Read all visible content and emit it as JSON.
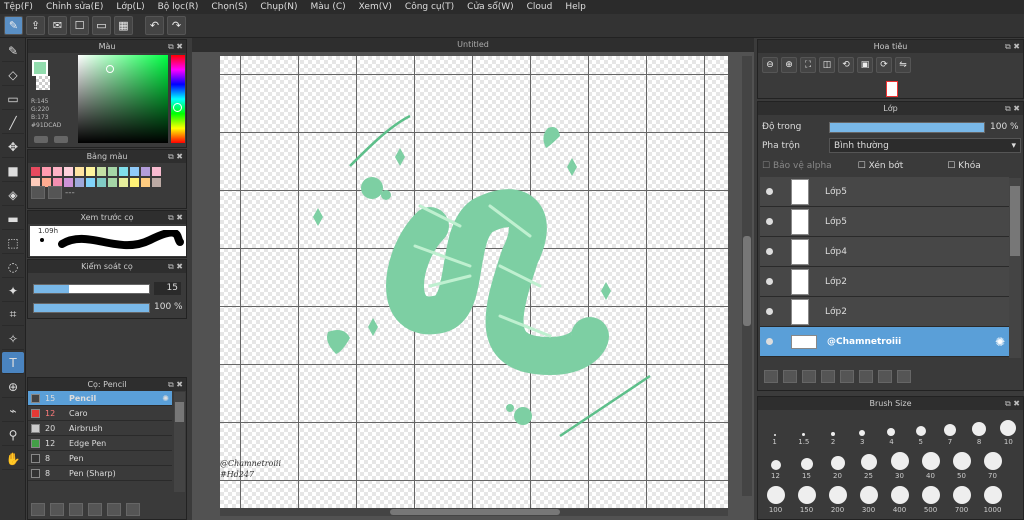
{
  "menu": [
    "Tệp(F)",
    "Chỉnh sửa(E)",
    "Lớp(L)",
    "Bộ lọc(R)",
    "Chọn(S)",
    "Chụp(N)",
    "Màu (C)",
    "Xem(V)",
    "Công cụ(T)",
    "Cửa sổ(W)",
    "Cloud",
    "Help"
  ],
  "panels": {
    "color": "Màu",
    "palette": "Bảng màu",
    "brush_preview": "Xem trước cọ",
    "brush_control": "Kiểm soát cọ",
    "brush_list": "Cọ: Pencil",
    "navigator": "Hoa tiêu",
    "layer": "Lớp",
    "brush_size": "Brush Size"
  },
  "color": {
    "r": "R:145",
    "g": "G:220",
    "b": "B:173",
    "hex": "#91DCAD",
    "main": "#91dcad"
  },
  "palette": {
    "colors": [
      "#e84a5f",
      "#ff9bb0",
      "#ffb3c6",
      "#ffd1dc",
      "#ffe4a1",
      "#fff59d",
      "#c5e1a5",
      "#a5d6a7",
      "#80deea",
      "#90caf9",
      "#b39ddb",
      "#f8bbd0",
      "#ffccbc",
      "#ffab91",
      "#f48fb1",
      "#ce93d8",
      "#9fa8da",
      "#81d4fa",
      "#80cbc4",
      "#a5d6a7",
      "#e6ee9c",
      "#fff176",
      "#ffcc80",
      "#bcaaa4"
    ],
    "dashes": "---"
  },
  "brush_preview": {
    "size": "1.09h"
  },
  "brush_control": {
    "size": "15",
    "opacity": "100 %"
  },
  "brushes": [
    {
      "size": "15",
      "name": "Pencil",
      "color": "#444",
      "sel": true
    },
    {
      "size": "12",
      "name": "Caro",
      "color": "#e53935"
    },
    {
      "size": "20",
      "name": "Airbrush",
      "color": "#ccc"
    },
    {
      "size": "12",
      "name": "Edge Pen",
      "color": "#43a047"
    },
    {
      "size": "8",
      "name": "Pen",
      "color": "#333"
    },
    {
      "size": "8",
      "name": "Pen (Sharp)",
      "color": "#333"
    }
  ],
  "canvas": {
    "title": "Untitled",
    "watermark1": "@Chamnetroiii",
    "watermark2": "#Hd247",
    "ink": "#7dcfa3",
    "ink2": "#5dbf8a"
  },
  "layer": {
    "opacity_label": "Độ trong",
    "opacity_value": "100 %",
    "blend_label": "Pha trộn",
    "blend_value": "Bình thường",
    "protect_alpha": "Bảo vệ alpha",
    "clip": "Xén bớt",
    "lock": "Khóa",
    "rows": [
      {
        "name": "Lớp5"
      },
      {
        "name": "Lớp5"
      },
      {
        "name": "Lớp4"
      },
      {
        "name": "Lớp2"
      },
      {
        "name": "Lớp2"
      },
      {
        "name": "@Chamnetroiii",
        "sel": true
      }
    ]
  },
  "brush_sizes": [
    [
      "1",
      "1.5",
      "2",
      "3",
      "4",
      "5",
      "7",
      "8",
      "10"
    ],
    [
      "12",
      "15",
      "20",
      "25",
      "30",
      "40",
      "50",
      "70"
    ],
    [
      "100",
      "150",
      "200",
      "300",
      "400",
      "500",
      "700",
      "1000"
    ]
  ]
}
